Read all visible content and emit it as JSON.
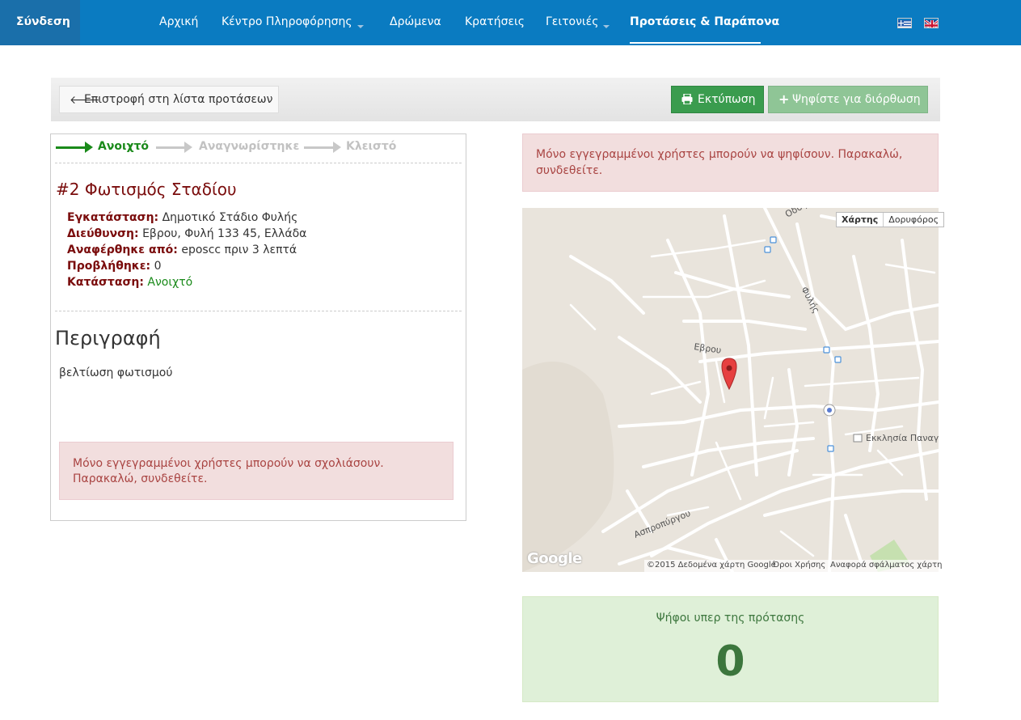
{
  "nav": {
    "login": "Σύνδεση",
    "items": [
      {
        "label": "Αρχική",
        "dropdown": false
      },
      {
        "label": "Κέντρο Πληροφόρησης",
        "dropdown": true
      },
      {
        "label": "Δρώμενα",
        "dropdown": false
      },
      {
        "label": "Κρατήσεις",
        "dropdown": false
      },
      {
        "label": "Γειτονιές",
        "dropdown": true
      },
      {
        "label": "Προτάσεις & Παράπονα",
        "dropdown": false,
        "active": true
      }
    ],
    "languages": [
      "greek-flag-icon",
      "uk-flag-icon"
    ]
  },
  "toolbar": {
    "back_label": "Επιστροφή στη λίστα προτάσεων",
    "print_label": "Εκτύπωση",
    "vote_label": "Ψηφίστε για διόρθωση"
  },
  "status_steps": [
    "Ανοιχτό",
    "Αναγνωρίστηκε",
    "Κλειστό"
  ],
  "issue": {
    "title": "#2 Φωτισμός Σταδίου",
    "fields": [
      {
        "key": "Εγκατάσταση:",
        "value": "Δημοτικό Στάδιο Φυλής"
      },
      {
        "key": "Διεύθυνση:",
        "value": "Εβρου, Φυλή 133 45, Ελλάδα"
      },
      {
        "key": "Αναφέρθηκε από:",
        "value": "eposcc πριν 3 λεπτά"
      },
      {
        "key": "Προβλήθηκε:",
        "value": "0"
      },
      {
        "key": "Κατάσταση:",
        "value": "Ανοιχτό"
      }
    ],
    "description_heading": "Περιγραφή",
    "description": "βελτίωση φωτισμού"
  },
  "alerts": {
    "comment_line1": "Μόνο εγγεγραμμένοι χρήστες μπορούν να σχολιάσουν.",
    "comment_line2": "Παρακαλώ, συνδεθείτε.",
    "vote_line1": "Μόνο εγγεγραμμένοι χρήστες μπορούν να ψηφίσουν. Παρακαλώ,",
    "vote_line2": "συνδεθείτε."
  },
  "map": {
    "type_map": "Χάρτης",
    "type_satellite": "Δορυφόρος",
    "street_labels": [
      "Οδός",
      "Φυλής",
      "Εβρου",
      "Ασπροπύργου"
    ],
    "poi": "Εκκλησία Παναγίας",
    "logo": "Google",
    "copyright": "©2015 Δεδομένα χάρτη Google",
    "terms": "Όροι Χρήσης",
    "report": "Αναφορά σφάλματος χάρτη"
  },
  "votes": {
    "label": "Ψήφοι υπερ της πρότασης",
    "count": "0"
  },
  "colors": {
    "navbar": "#0a7bc1",
    "success": "#3a9c4e",
    "danger_text": "#a94442",
    "title": "#7a0c0c",
    "open_status": "#1a8a1a"
  }
}
